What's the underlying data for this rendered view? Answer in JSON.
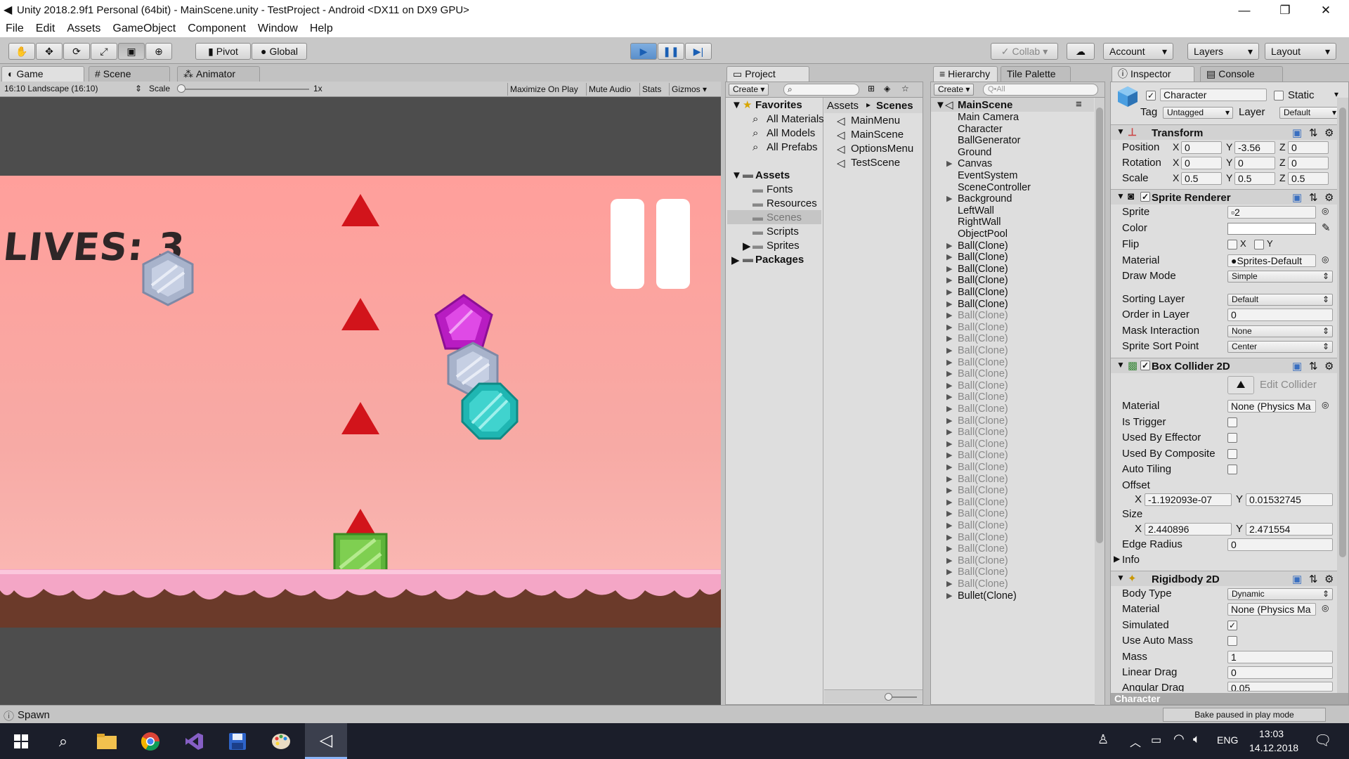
{
  "window": {
    "title": "Unity 2018.2.9f1 Personal (64bit) - MainScene.unity - TestProject - Android <DX11 on DX9 GPU>",
    "minimize": "—",
    "restore": "❐",
    "close": "✕"
  },
  "menu": [
    "File",
    "Edit",
    "Assets",
    "GameObject",
    "Component",
    "Window",
    "Help"
  ],
  "toolbar": {
    "pivot": "Pivot",
    "global": "Global",
    "collab": "Collab",
    "account": "Account",
    "layers": "Layers",
    "layout": "Layout"
  },
  "tabs": {
    "game": "Game",
    "scene": "Scene",
    "animator": "Animator",
    "project": "Project",
    "hierarchy": "Hierarchy",
    "tile_palette": "Tile Palette",
    "inspector": "Inspector",
    "console": "Console"
  },
  "game": {
    "aspect": "16:10 Landscape (16:10)",
    "scale_label": "Scale",
    "scale_value": "1x",
    "maximize": "Maximize On Play",
    "mute": "Mute Audio",
    "stats": "Stats",
    "gizmos": "Gizmos",
    "lives": "LIVES: 3"
  },
  "project": {
    "create": "Create",
    "favorites": "Favorites",
    "fav_items": [
      "All Materials",
      "All Models",
      "All Prefabs"
    ],
    "assets": "Assets",
    "asset_items": [
      "Fonts",
      "Resources",
      "Scenes",
      "Scripts",
      "Sprites"
    ],
    "packages": "Packages",
    "path_root": "Assets",
    "path_leaf": "Scenes",
    "scenes": [
      "MainMenu",
      "MainScene",
      "OptionsMenu",
      "TestScene"
    ]
  },
  "hierarchy": {
    "create": "Create",
    "search": "Q•All",
    "scene": "MainScene",
    "items": [
      "Main Camera",
      "Character",
      "BallGenerator",
      "Ground",
      "Canvas",
      "EventSystem",
      "SceneController",
      "Background",
      "LeftWall",
      "RightWall",
      "ObjectPool"
    ],
    "ball": "Ball(Clone)",
    "bullet": "Bullet(Clone)"
  },
  "inspector": {
    "name": "Character",
    "static": "Static",
    "tag_label": "Tag",
    "tag": "Untagged",
    "layer_label": "Layer",
    "layer": "Default",
    "transform": {
      "title": "Transform",
      "position": "Position",
      "rotation": "Rotation",
      "scale": "Scale",
      "pos": [
        "0",
        "-3.56",
        "0"
      ],
      "rot": [
        "0",
        "0",
        "0"
      ],
      "scl": [
        "0.5",
        "0.5",
        "0.5"
      ]
    },
    "sprite_renderer": {
      "title": "Sprite Renderer",
      "sprite": "Sprite",
      "sprite_val": "2",
      "color": "Color",
      "flip": "Flip",
      "material": "Material",
      "material_val": "Sprites-Default",
      "draw_mode": "Draw Mode",
      "draw_mode_val": "Simple",
      "sorting_layer": "Sorting Layer",
      "sorting_layer_val": "Default",
      "order": "Order in Layer",
      "order_val": "0",
      "mask": "Mask Interaction",
      "mask_val": "None",
      "sort_point": "Sprite Sort Point",
      "sort_point_val": "Center"
    },
    "box_collider": {
      "title": "Box Collider 2D",
      "edit": "Edit Collider",
      "material": "Material",
      "material_val": "None (Physics Ma",
      "is_trigger": "Is Trigger",
      "effector": "Used By Effector",
      "composite": "Used By Composite",
      "auto_tiling": "Auto Tiling",
      "offset": "Offset",
      "offset_x": "-1.192093e-07",
      "offset_y": "0.01532745",
      "size": "Size",
      "size_x": "2.440896",
      "size_y": "2.471554",
      "edge": "Edge Radius",
      "edge_val": "0",
      "info": "Info"
    },
    "rigidbody": {
      "title": "Rigidbody 2D",
      "body_type": "Body Type",
      "body_type_val": "Dynamic",
      "material": "Material",
      "material_val": "None (Physics Ma",
      "simulated": "Simulated",
      "auto_mass": "Use Auto Mass",
      "mass": "Mass",
      "mass_val": "1",
      "linear_drag": "Linear Drag",
      "linear_drag_val": "0",
      "angular_drag": "Angular Drag",
      "angular_drag_val": "0.05"
    },
    "footer": "Character",
    "bake": "Bake paused in play mode"
  },
  "status": "Spawn",
  "taskbar": {
    "lang": "ENG",
    "time": "13:03",
    "date": "14.12.2018"
  }
}
